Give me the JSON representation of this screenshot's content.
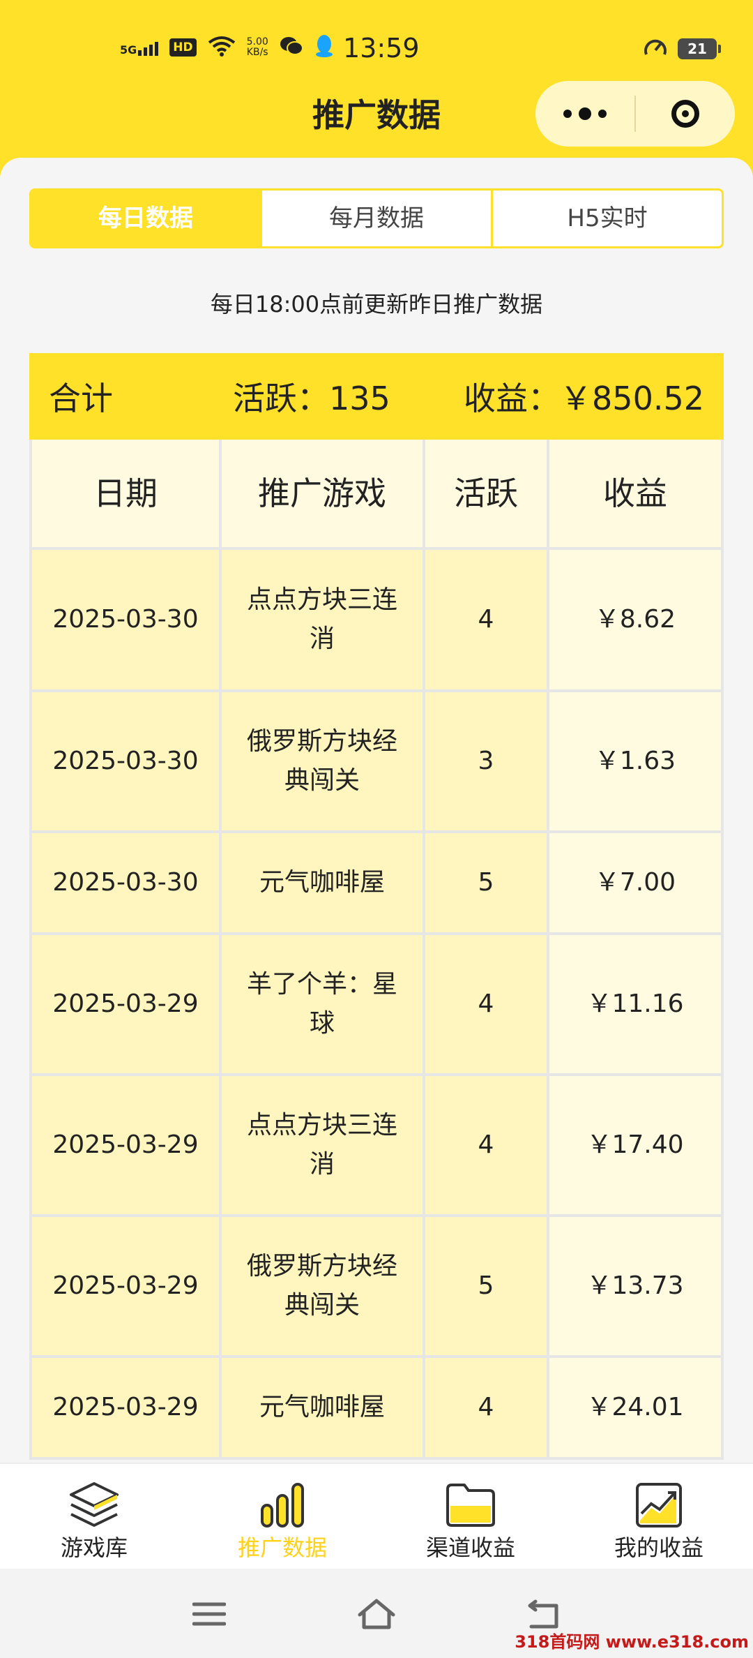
{
  "status_bar": {
    "network": "5G",
    "hd": "HD",
    "speed_value": "5.00",
    "speed_unit": "KB/s",
    "time": "13:59",
    "battery": "21"
  },
  "header": {
    "title": "推广数据"
  },
  "tabs": [
    {
      "label": "每日数据",
      "active": true
    },
    {
      "label": "每月数据",
      "active": false
    },
    {
      "label": "H5实时",
      "active": false
    }
  ],
  "notice": "每日18:00点前更新昨日推广数据",
  "total": {
    "label": "合计",
    "active": "活跃：135",
    "income": "收益：￥850.52"
  },
  "table": {
    "headers": [
      "日期",
      "推广游戏",
      "活跃",
      "收益"
    ],
    "rows": [
      {
        "date": "2025-03-30",
        "game": "点点方块三连消",
        "active": "4",
        "income": "￥8.62"
      },
      {
        "date": "2025-03-30",
        "game": "俄罗斯方块经典闯关",
        "active": "3",
        "income": "￥1.63"
      },
      {
        "date": "2025-03-30",
        "game": "元气咖啡屋",
        "active": "5",
        "income": "￥7.00"
      },
      {
        "date": "2025-03-29",
        "game": "羊了个羊：星球",
        "active": "4",
        "income": "￥11.16"
      },
      {
        "date": "2025-03-29",
        "game": "点点方块三连消",
        "active": "4",
        "income": "￥17.40"
      },
      {
        "date": "2025-03-29",
        "game": "俄罗斯方块经典闯关",
        "active": "5",
        "income": "￥13.73"
      },
      {
        "date": "2025-03-29",
        "game": "元气咖啡屋",
        "active": "4",
        "income": "￥24.01"
      }
    ]
  },
  "tabbar": [
    {
      "label": "游戏库",
      "icon": "layers-icon",
      "active": false
    },
    {
      "label": "推广数据",
      "icon": "bar-chart-icon",
      "active": true
    },
    {
      "label": "渠道收益",
      "icon": "folder-icon",
      "active": false
    },
    {
      "label": "我的收益",
      "icon": "trend-chart-icon",
      "active": false
    }
  ],
  "watermark": "318首码网 www.e318.com",
  "colors": {
    "accent": "#ffe12a",
    "active_tab_text": "#ffd21a"
  }
}
